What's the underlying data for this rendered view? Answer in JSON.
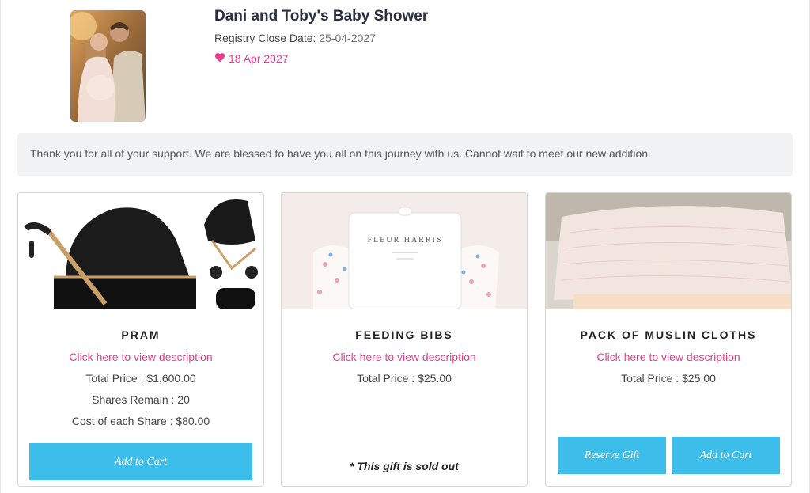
{
  "event": {
    "title": "Dani and Toby's Baby Shower",
    "close_label": "Registry Close Date:",
    "close_date": "25-04-2027",
    "date": "18 Apr 2027",
    "message": "Thank you for all of your support. We are blessed to have you all on this journey with us. Cannot wait to meet our new addition."
  },
  "colors": {
    "accent_pink": "#e83e8c",
    "button_blue": "#3dbde9",
    "panel_grey": "#f1f2f4"
  },
  "gifts": [
    {
      "name": "PRAM",
      "link": "Click here to view description",
      "total_price": "Total Price : $1,600.00",
      "shares_remain": "Shares Remain : 20",
      "share_cost": "Cost of each Share : $80.00",
      "button": "Add to Cart"
    },
    {
      "name": "FEEDING BIBS",
      "link": "Click here to view description",
      "total_price": "Total Price : $25.00",
      "image_brand": "FLEUR HARRIS",
      "sold_out": "* This gift is sold out"
    },
    {
      "name": "PACK OF MUSLIN CLOTHS",
      "link": "Click here to view description",
      "total_price": "Total Price : $25.00",
      "reserve_button": "Reserve Gift",
      "button": "Add to Cart"
    }
  ]
}
